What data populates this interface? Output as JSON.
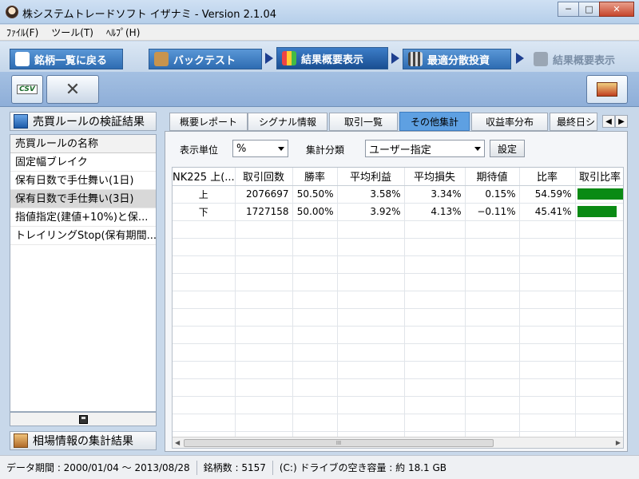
{
  "window": {
    "title": "株システムトレードソフト イザナミ - Version 2.1.04",
    "minimize": "─",
    "maximize": "□",
    "close": "✕"
  },
  "menu": [
    "ﾌｧｲﾙ(F)",
    "ツール(T)",
    "ﾍﾙﾌﾟ(H)"
  ],
  "nav": {
    "tabs": [
      {
        "label": "銘柄一覧に戻る",
        "icon": "eye-icon"
      },
      {
        "label": "バックテスト",
        "icon": "bag-icon"
      },
      {
        "label": "結果概要表示",
        "icon": "chart-icon"
      },
      {
        "label": "最適分散投資",
        "icon": "grid-icon"
      },
      {
        "label": "結果概要表示",
        "icon": "factory-icon"
      }
    ]
  },
  "toolbar": {
    "csv_label": "CSV",
    "tools_icon": "tools-icon",
    "export_icon": "export-icon"
  },
  "left": {
    "section_title": "売買ルールの検証結果",
    "list_header": "売買ルールの名称",
    "items": [
      "固定幅ブレイク",
      "保有日数で手仕舞い(1日)",
      "保有日数で手仕舞い(3日)",
      "指値指定(建値+10%)と保...",
      "トレイリングStop(保有期間..."
    ],
    "selected_index": 2,
    "bottom_section_title": "相場情報の集計結果"
  },
  "right": {
    "subtabs": [
      "概要レポート",
      "シグナル情報",
      "取引一覧",
      "その他集計",
      "収益率分布",
      "最終日シ"
    ],
    "active_subtab": 3,
    "display_unit_label": "表示単位",
    "display_unit_value": "%",
    "agg_label": "集計分類",
    "agg_value": "ユーザー指定",
    "settings_button": "設定",
    "columns": [
      "NK225 上(...",
      "取引回数",
      "勝率",
      "平均利益",
      "平均損失",
      "期待値",
      "比率",
      "取引比率"
    ],
    "rows": [
      {
        "label": "上",
        "trades": "2076697",
        "win": "50.50%",
        "avg_profit": "3.58%",
        "avg_loss": "3.34%",
        "expect": "0.15%",
        "ratio": "54.59%",
        "bar": 0.5459
      },
      {
        "label": "下",
        "trades": "1727158",
        "win": "50.00%",
        "avg_profit": "3.92%",
        "avg_loss": "4.13%",
        "expect": "−0.11%",
        "ratio": "45.41%",
        "bar": 0.4541
      }
    ],
    "scroll_thumb": "III"
  },
  "status": {
    "period": "データ期間 : 2000/01/04 〜 2013/08/28",
    "count": "銘柄数 : 5157",
    "disk": "(C:) ドライブの空き容量 : 約 18.1 GB"
  },
  "colors": {
    "nav_tab": "#2e6cb2",
    "active_subtab": "#5ea0e2",
    "bar": "#0a8a14"
  }
}
